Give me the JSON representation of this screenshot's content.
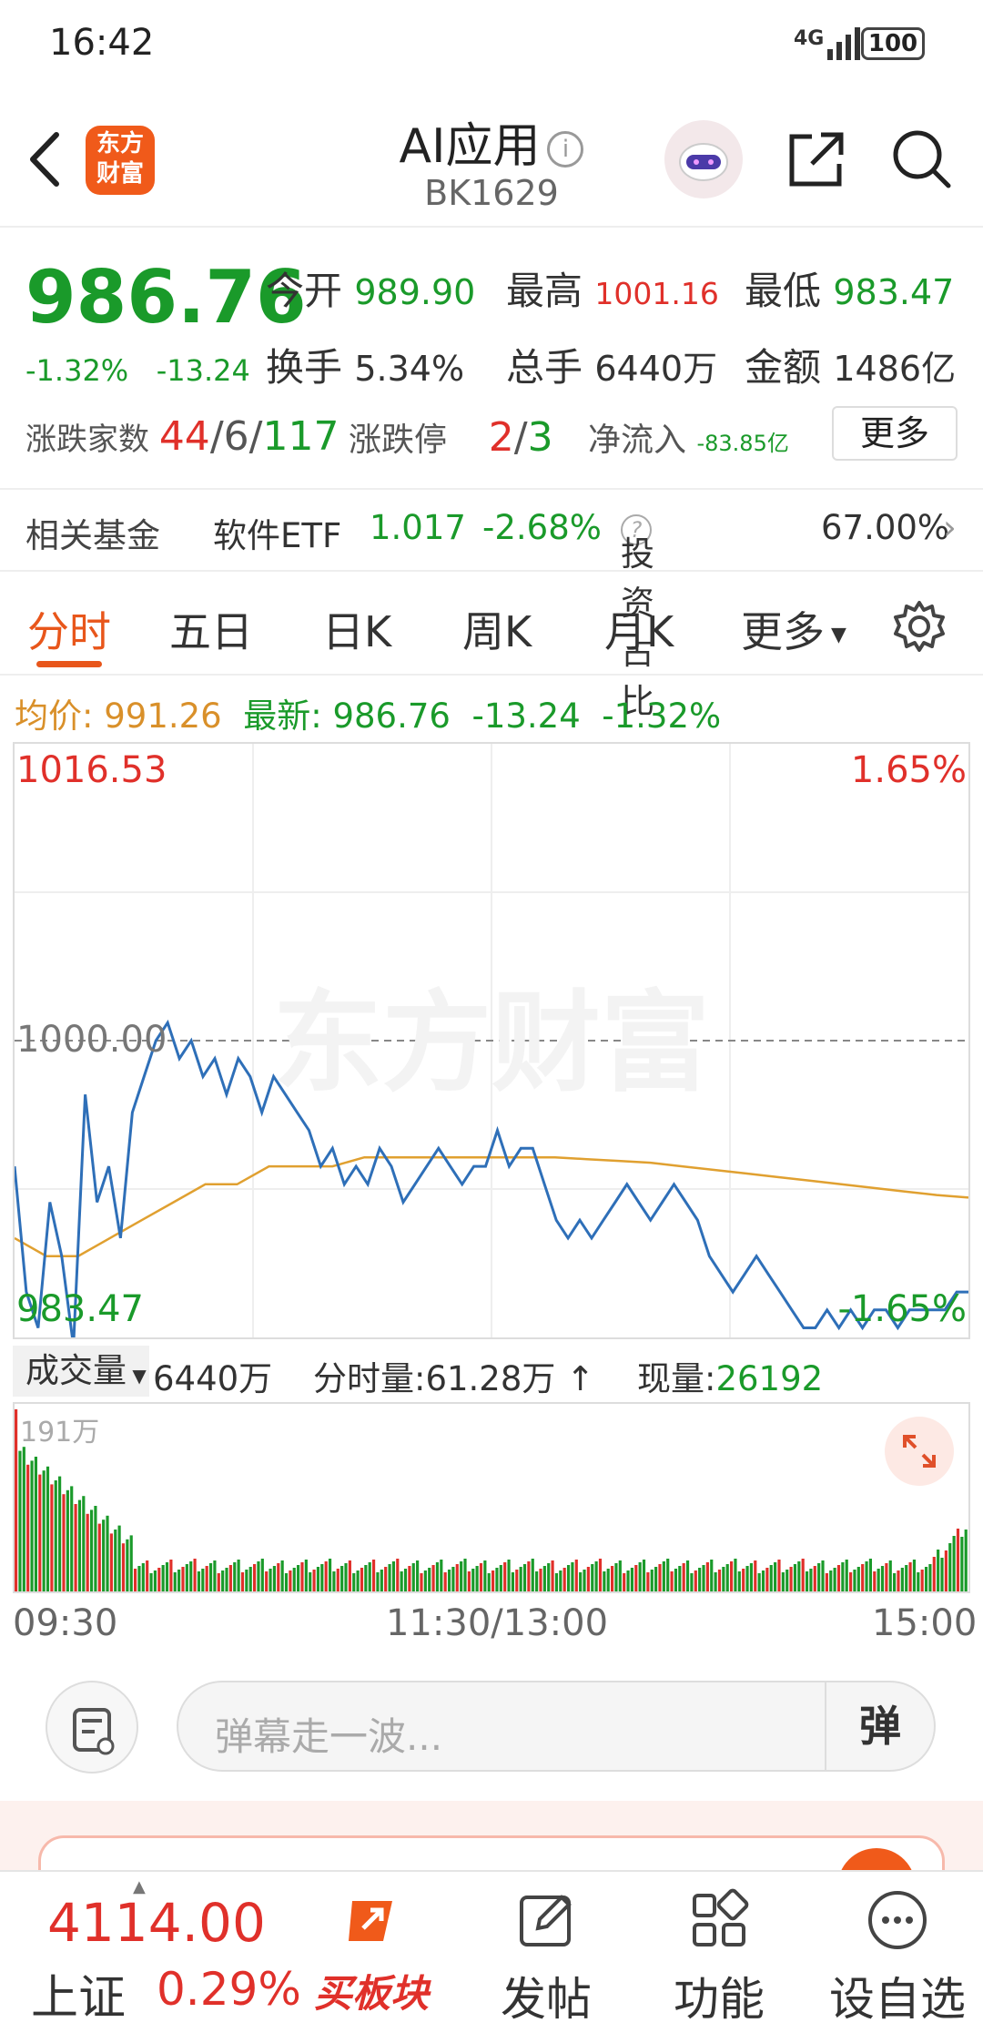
{
  "status": {
    "time": "16:42",
    "network": "4G",
    "battery": "100"
  },
  "header": {
    "logo_text": "东方财富",
    "title": "AI应用",
    "code": "BK1629"
  },
  "quote": {
    "price": "986.76",
    "change_pct": "-1.32%",
    "change_abs": "-13.24",
    "open_label": "今开",
    "open": "989.90",
    "high_label": "最高",
    "high": "1001.16",
    "low_label": "最低",
    "low": "983.47",
    "turnover_label": "换手",
    "turnover": "5.34%",
    "volume_label": "总手",
    "volume": "6440万",
    "amount_label": "金额",
    "amount": "1486亿",
    "breadth_label": "涨跌家数",
    "breadth_up": "44",
    "breadth_flat": "6",
    "breadth_down": "117",
    "limit_label": "涨跌停",
    "limit_up": "2",
    "limit_down": "3",
    "netflow_label": "净流入",
    "netflow": "-83.85亿",
    "more_label": "更多"
  },
  "fund": {
    "label": "相关基金",
    "name": "软件ETF",
    "price": "1.017",
    "pct": "-2.68%",
    "ratio_label": "投资占比",
    "ratio": "67.00%"
  },
  "tabs": [
    {
      "label": "分时"
    },
    {
      "label": "五日"
    },
    {
      "label": "日K"
    },
    {
      "label": "周K"
    },
    {
      "label": "月K"
    },
    {
      "label": "更多"
    }
  ],
  "avgline": {
    "avg_label": "均价:",
    "avg": "991.26",
    "last_label": "最新:",
    "last": "986.76",
    "chg": "-13.24",
    "pct": "-1.32%"
  },
  "chart_labels": {
    "top_price": "1016.53",
    "top_pct": "1.65%",
    "ref_price": "1000.00",
    "bottom_price": "983.47",
    "bottom_pct": "-1.65%",
    "watermark": "东方财富"
  },
  "volume_bar": {
    "selector": "成交量",
    "total": "6440万",
    "minute_label": "分时量:",
    "minute": "61.28万",
    "now_label": "现量:",
    "now": "26192",
    "max_label": "191万"
  },
  "time_axis": {
    "start": "09:30",
    "mid": "11:30/13:00",
    "end": "15:00"
  },
  "comment": {
    "placeholder": "弹幕走一波...",
    "send": "弹"
  },
  "nav": {
    "index_value": "4114.00",
    "index_name": "上证",
    "index_pct": "0.29%",
    "buy_label": "买板块",
    "post_label": "发帖",
    "func_label": "功能",
    "watch_label": "设自选"
  },
  "chart_data": {
    "type": "line",
    "ylim": [
      983.47,
      1016.53
    ],
    "reference": 1000.0,
    "series": [
      {
        "values": [
          993,
          986,
          984,
          991,
          988,
          983,
          997,
          991,
          993,
          989,
          996,
          998,
          1000,
          1001,
          999,
          1000,
          998,
          999,
          997,
          999,
          998,
          996,
          998,
          997,
          996,
          995,
          993,
          994,
          992,
          993,
          992,
          994,
          993,
          991,
          992,
          993,
          994,
          993,
          992,
          993,
          993,
          995,
          993,
          994,
          994,
          992,
          990,
          989,
          990,
          989,
          990,
          991,
          992,
          991,
          990,
          991,
          992,
          991,
          990,
          988,
          987,
          986,
          987,
          988,
          987,
          986,
          985,
          984,
          984,
          985,
          984,
          985,
          984,
          985,
          985,
          984,
          985,
          985,
          985,
          985,
          986,
          986
        ]
      },
      {
        "values": [
          989,
          988,
          988,
          989,
          990,
          991,
          992,
          992,
          993,
          993,
          993,
          993.5,
          993.5,
          993.5,
          993.5,
          993.5,
          993.5,
          993.5,
          993.4,
          993.3,
          993.2,
          993,
          992.8,
          992.6,
          992.4,
          992.2,
          992,
          991.8,
          991.6,
          991.4,
          991.26
        ]
      }
    ]
  }
}
